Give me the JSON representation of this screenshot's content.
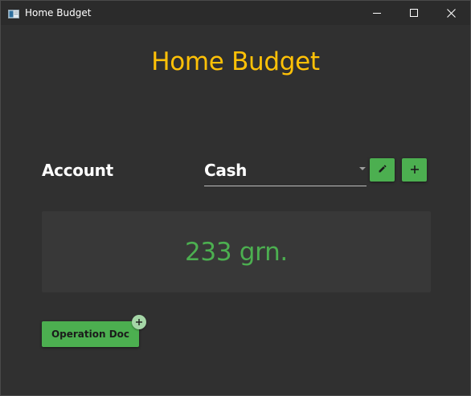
{
  "window": {
    "title": "Home Budget",
    "icons": {
      "app": "app-window-icon",
      "minimize": "minimize-icon",
      "maximize": "maximize-icon",
      "close": "close-icon"
    }
  },
  "header": {
    "title": "Home Budget",
    "title_color": "#ffc107"
  },
  "account": {
    "label": "Account",
    "selected": "Cash",
    "edit_icon": "pencil-icon",
    "add_icon": "plus-icon"
  },
  "balance": {
    "value": "233 grn.",
    "color": "#4caf50"
  },
  "operation": {
    "button_label": "Operation Doc",
    "badge_icon": "plus-icon"
  },
  "colors": {
    "background": "#303030",
    "accent": "#4caf50",
    "panel": "#383838"
  }
}
